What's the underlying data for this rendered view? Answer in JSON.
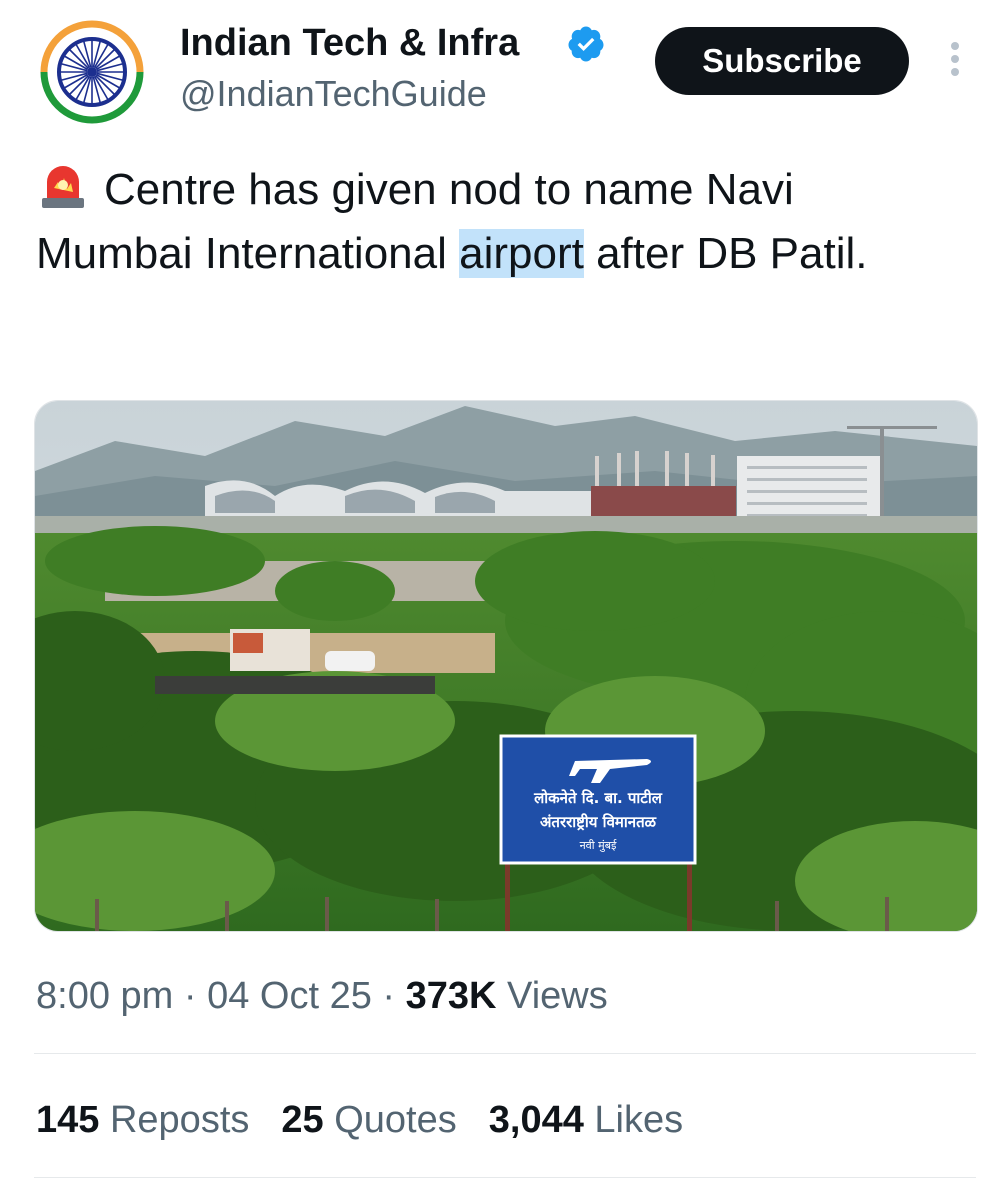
{
  "account": {
    "name": "Indian Tech & Infra",
    "handle": "@IndianTechGuide",
    "verified": true,
    "subscribe_label": "Subscribe"
  },
  "tweet": {
    "emoji_icon": "police-siren-icon",
    "text_before": "Centre has given nod to name Navi Mumbai International ",
    "text_highlight": "airport",
    "text_after": " after DB Patil."
  },
  "media": {
    "sign_line1": "लोकनेते दि. बा. पाटील",
    "sign_line2": "अंतरराष्ट्रीय विमानतळ",
    "sign_line3": "नवी मुंबई"
  },
  "meta": {
    "time": "8:00 pm",
    "date": "04 Oct 25",
    "views_count": "373K",
    "views_label": "Views"
  },
  "stats": {
    "reposts_count": "145",
    "reposts_label": "Reposts",
    "quotes_count": "25",
    "quotes_label": "Quotes",
    "likes_count": "3,044",
    "likes_label": "Likes"
  },
  "colors": {
    "text": "#0f1419",
    "secondary": "#536471",
    "verified": "#1d9bf0",
    "highlight": "#c2e2fa",
    "sign_blue": "#1f4fa8"
  }
}
